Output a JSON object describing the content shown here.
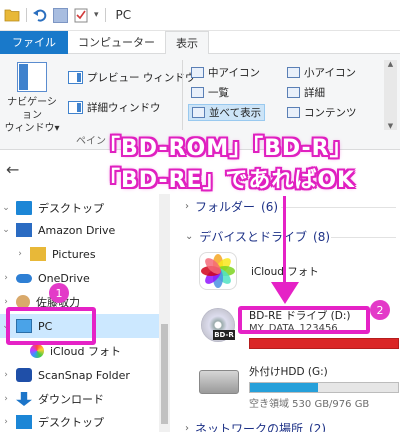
{
  "window": {
    "title": "PC"
  },
  "tabs": [
    "ファイル",
    "コンピューター",
    "表示"
  ],
  "ribbon": {
    "nav_pane_label_1": "ナビゲーション",
    "nav_pane_label_2": "ウィンドウ▾",
    "preview_pane": "プレビュー ウィンドウ",
    "details_pane": "詳細ウィンドウ",
    "group_label": "ペイン",
    "layout": {
      "medium_icons": "中アイコン",
      "small_icons": "小アイコン",
      "list": "一覧",
      "details": "詳細",
      "tiles": "並べて表示",
      "content": "コンテンツ"
    }
  },
  "nav": {
    "items": [
      {
        "label": "デスクトップ"
      },
      {
        "label": "Amazon Drive"
      },
      {
        "label": "Pictures"
      },
      {
        "label": "OneDrive"
      },
      {
        "label": "佐藤敬力"
      },
      {
        "label": "PC"
      },
      {
        "label": "iCloud フォト"
      },
      {
        "label": "ScanSnap Folder"
      },
      {
        "label": "ダウンロード"
      },
      {
        "label": "デスクトップ"
      }
    ]
  },
  "content": {
    "folders_section": "フォルダー",
    "folders_count": "(6)",
    "devices_section": "デバイスとドライブ",
    "devices_count": "(8)",
    "network_section": "ネットワークの場所",
    "network_count": "(2)",
    "icloud_label": "iCloud フォト",
    "bd_drive_label": "BD-RE ドライブ (D:)",
    "bd_disc_label": "MY_DATA_123456",
    "hdd_label": "外付けHDD (G:)",
    "hdd_free": "空き領域 530 GB/976 GB",
    "hdd_used_fraction": 0.457
  },
  "annotations": {
    "line1": "「BD-ROM」「BD-R」",
    "line2": "「BD-RE」であればOK",
    "badge1": "1",
    "badge2": "2",
    "accent": "#e522c6"
  }
}
